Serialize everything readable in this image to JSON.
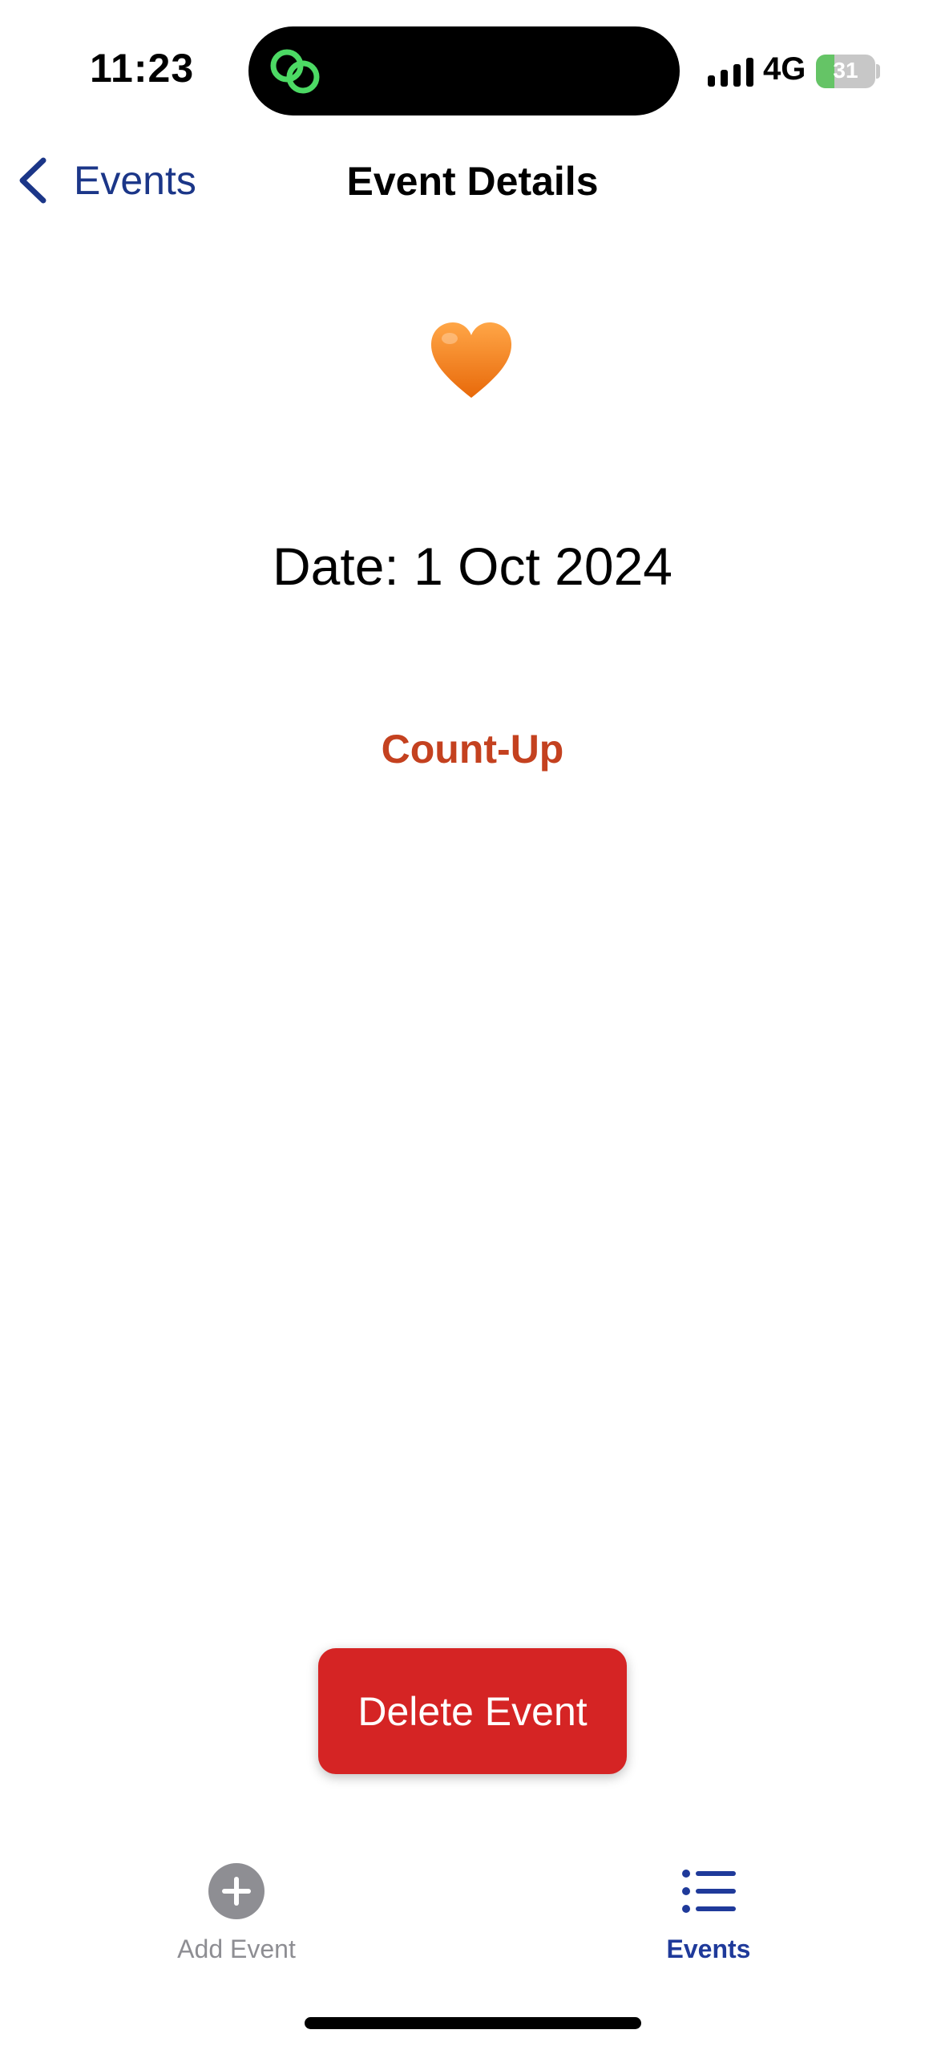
{
  "status_bar": {
    "time": "11:23",
    "network": "4G",
    "battery": "31",
    "battery_level": 0.31,
    "colors": {
      "battery_fill": "#65c466",
      "island_icon": "#4cd964"
    }
  },
  "nav": {
    "back_label": "Events",
    "title": "Event Details"
  },
  "event": {
    "emoji": "orange-heart",
    "date_text": "Date: 1 Oct 2024",
    "mode": "Count-Up"
  },
  "actions": {
    "delete_label": "Delete Event"
  },
  "tabs": [
    {
      "label": "Add Event",
      "icon": "plus-circle-icon",
      "selected": false
    },
    {
      "label": "Events",
      "icon": "list-icon",
      "selected": true
    }
  ],
  "colors": {
    "accent": "#1b3688",
    "count_up": "#c4411f",
    "delete": "#d52424"
  }
}
